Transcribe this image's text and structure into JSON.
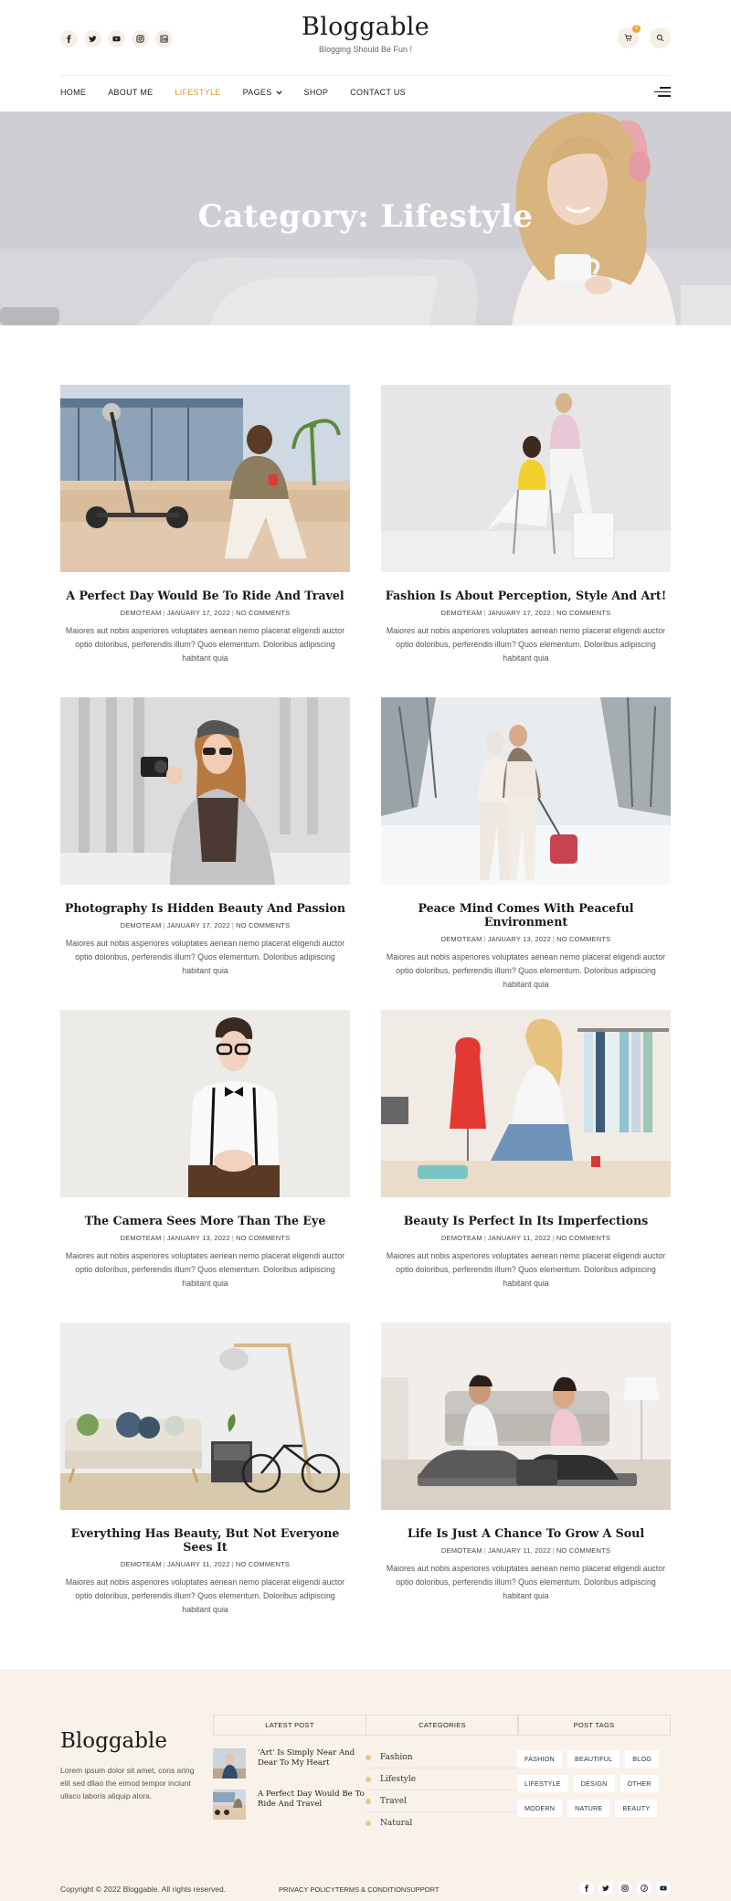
{
  "header": {
    "brand": "Bloggable",
    "tagline": "Blogging Should Be Fun !",
    "social_icons": [
      "facebook-icon",
      "twitter-icon",
      "youtube-icon",
      "instagram-icon",
      "linkedin-icon"
    ],
    "cart_count": "0"
  },
  "nav": {
    "items": [
      {
        "label": "HOME"
      },
      {
        "label": "ABOUT ME"
      },
      {
        "label": "LIFESTYLE",
        "active": true
      },
      {
        "label": "PAGES",
        "dropdown": true
      },
      {
        "label": "SHOP"
      },
      {
        "label": "CONTACT US"
      }
    ]
  },
  "hero": {
    "title": "Category: Lifestyle"
  },
  "posts": [
    {
      "title": "A Perfect Day Would Be To Ride And Travel",
      "author": "DEMOTEAM",
      "date": "JANUARY 17, 2022",
      "comments": "NO COMMENTS",
      "excerpt": "Maiores aut nobis asperiores voluptates aenean nemo placerat eligendi auctor optio doloribus, perferendis illum? Quos elementum. Doloribus adipiscing habitant quia"
    },
    {
      "title": "Fashion Is About Perception, Style And Art!",
      "author": "DEMOTEAM",
      "date": "JANUARY 17, 2022",
      "comments": "NO COMMENTS",
      "excerpt": "Maiores aut nobis asperiores voluptates aenean nemo placerat eligendi auctor optio doloribus, perferendis illum? Quos elementum. Doloribus adipiscing habitant quia"
    },
    {
      "title": "Photography Is Hidden Beauty And Passion",
      "author": "DEMOTEAM",
      "date": "JANUARY 17, 2022",
      "comments": "NO COMMENTS",
      "excerpt": "Maiores aut nobis asperiores voluptates aenean nemo placerat eligendi auctor optio doloribus, perferendis illum? Quos elementum. Doloribus adipiscing habitant quia"
    },
    {
      "title": "Peace Mind Comes With Peaceful Environment",
      "author": "DEMOTEAM",
      "date": "JANUARY 13, 2022",
      "comments": "NO COMMENTS",
      "excerpt": "Maiores aut nobis asperiores voluptates aenean nemo placerat eligendi auctor optio doloribus, perferendis illum? Quos elementum. Doloribus adipiscing habitant quia"
    },
    {
      "title": "The Camera Sees More Than The Eye",
      "author": "DEMOTEAM",
      "date": "JANUARY 13, 2022",
      "comments": "NO COMMENTS",
      "excerpt": "Maiores aut nobis asperiores voluptates aenean nemo placerat eligendi auctor optio doloribus, perferendis illum? Quos elementum. Doloribus adipiscing habitant quia"
    },
    {
      "title": "Beauty Is Perfect In Its Imperfections",
      "author": "DEMOTEAM",
      "date": "JANUARY 11, 2022",
      "comments": "NO COMMENTS",
      "excerpt": "Maiores aut nobis asperiores voluptates aenean nemo placerat eligendi auctor optio doloribus, perferendis illum? Quos elementum. Doloribus adipiscing habitant quia"
    },
    {
      "title": "Everything Has Beauty, But Not Everyone Sees It",
      "author": "DEMOTEAM",
      "date": "JANUARY 11, 2022",
      "comments": "NO COMMENTS",
      "excerpt": "Maiores aut nobis asperiores voluptates aenean nemo placerat eligendi auctor optio doloribus, perferendis illum? Quos elementum. Doloribus adipiscing habitant quia"
    },
    {
      "title": "Life Is Just A Chance To Grow A Soul",
      "author": "DEMOTEAM",
      "date": "JANUARY 11, 2022",
      "comments": "NO COMMENTS",
      "excerpt": "Maiores aut nobis asperiores voluptates aenean nemo placerat eligendi auctor optio doloribus, perferendis illum? Quos elementum. Doloribus adipiscing habitant quia"
    }
  ],
  "footer": {
    "brand": "Bloggable",
    "about": "Lorem ipsum dolor sit amet, cons aring elit sed dllao the eimod tempor inciunt ullaco laboris aliquip alora.",
    "latest_post": {
      "title": "LATEST POST",
      "items": [
        "'Art' Is Simply Near And Dear To My Heart",
        "A Perfect Day Would Be To Ride And Travel"
      ]
    },
    "categories": {
      "title": "CATEGORIES",
      "items": [
        "Fashion",
        "Lifestyle",
        "Travel",
        "Natural"
      ]
    },
    "post_tags": {
      "title": "POST TAGS",
      "items": [
        "FASHION",
        "BEAUTIFUL",
        "BLOG",
        "LIFESTYLE",
        "DESIGN",
        "OTHER",
        "MODERN",
        "NATURE",
        "BEAUTY"
      ]
    },
    "copyright": "Copyright © 2022 Bloggable. All rights reserved.",
    "links": [
      "PRIVACY POLICY",
      "TERMS & CONDITION",
      "SUPPORT"
    ],
    "social_icons": [
      "facebook-icon",
      "twitter-icon",
      "instagram-icon",
      "pinterest-icon",
      "youtube-icon"
    ]
  },
  "colors": {
    "accent": "#d79a3e",
    "footer_bg": "#f8f2ea",
    "icon_bg": "#f6efe6"
  }
}
